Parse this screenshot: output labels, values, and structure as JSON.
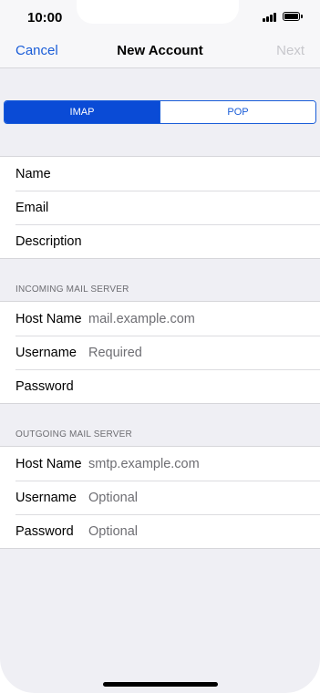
{
  "status_bar": {
    "time": "10:00"
  },
  "nav": {
    "cancel": "Cancel",
    "title": "New Account",
    "next": "Next"
  },
  "segment": {
    "options": [
      "IMAP",
      "POP"
    ],
    "selected": "IMAP"
  },
  "account": {
    "rows": [
      {
        "label": "Name",
        "value": ""
      },
      {
        "label": "Email",
        "value": ""
      },
      {
        "label": "Description",
        "value": ""
      }
    ]
  },
  "incoming": {
    "header": "INCOMING MAIL SERVER",
    "rows": [
      {
        "label": "Host Name",
        "value": "mail.example.com"
      },
      {
        "label": "Username",
        "value": "Required"
      },
      {
        "label": "Password",
        "value": ""
      }
    ]
  },
  "outgoing": {
    "header": "OUTGOING MAIL SERVER",
    "rows": [
      {
        "label": "Host Name",
        "value": "smtp.example.com"
      },
      {
        "label": "Username",
        "value": "Optional"
      },
      {
        "label": "Password",
        "value": "Optional"
      }
    ]
  }
}
